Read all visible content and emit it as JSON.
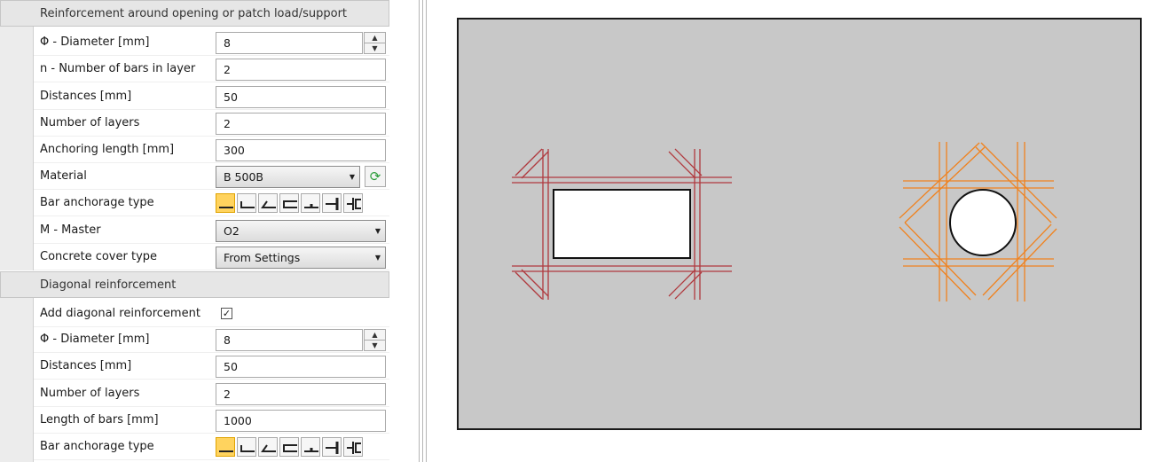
{
  "panel": {
    "section1": {
      "title": "Reinforcement around opening or patch load/support",
      "diameter": {
        "label": "Φ - Diameter [mm]",
        "value": "8"
      },
      "bars_in_layer": {
        "label": "n - Number of bars in layer",
        "value": "2"
      },
      "distances": {
        "label": "Distances [mm]",
        "value": "50"
      },
      "layers": {
        "label": "Number of layers",
        "value": "2"
      },
      "anchoring": {
        "label": "Anchoring length [mm]",
        "value": "300"
      },
      "material": {
        "label": "Material",
        "value": "B 500B"
      },
      "anchorage": {
        "label": "Bar anchorage type"
      },
      "master": {
        "label": "M - Master",
        "value": "O2"
      },
      "cover": {
        "label": "Concrete cover type",
        "value": "From Settings"
      }
    },
    "section2": {
      "title": "Diagonal reinforcement",
      "add_diag": {
        "label": "Add diagonal reinforcement",
        "checked": true
      },
      "diameter": {
        "label": "Φ - Diameter [mm]",
        "value": "8"
      },
      "distances": {
        "label": "Distances [mm]",
        "value": "50"
      },
      "layers": {
        "label": "Number of layers",
        "value": "2"
      },
      "length": {
        "label": "Length of bars [mm]",
        "value": "1000"
      },
      "anchorage": {
        "label": "Bar anchorage type"
      }
    }
  },
  "icons": {
    "spin_up": "▲",
    "spin_down": "▼",
    "dropdown": "▼",
    "refresh": "⟳",
    "check": "✓"
  },
  "colors": {
    "slab": "#c8c8c8",
    "rect_bars": "#b0393e",
    "circle_bars": "#f0821e",
    "anchorage_selected": "#ffd35e"
  }
}
